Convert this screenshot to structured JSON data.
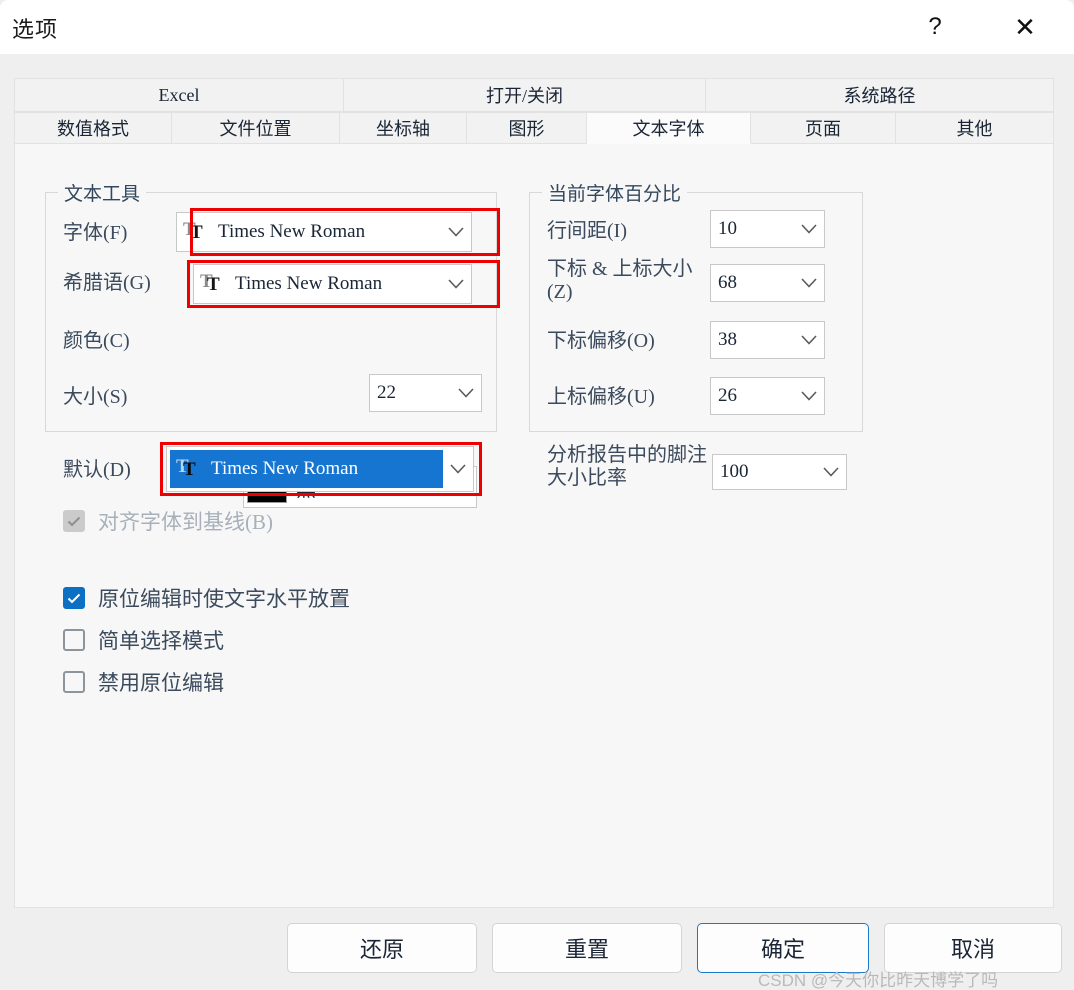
{
  "window": {
    "title": "选项",
    "help_label": "?",
    "close_label": "✕"
  },
  "tabs": {
    "row1": [
      {
        "label": "Excel",
        "active": false
      },
      {
        "label": "打开/关闭",
        "active": false
      },
      {
        "label": "系统路径",
        "active": false
      }
    ],
    "row2": [
      {
        "label": "数值格式",
        "active": false
      },
      {
        "label": "文件位置",
        "active": false
      },
      {
        "label": "坐标轴",
        "active": false
      },
      {
        "label": "图形",
        "active": false
      },
      {
        "label": "文本字体",
        "active": true
      },
      {
        "label": "页面",
        "active": false
      },
      {
        "label": "其他",
        "active": false
      }
    ]
  },
  "text_tools": {
    "group_title": "文本工具",
    "font_label": "字体(F)",
    "font_value": "Times New Roman",
    "greek_label": "希腊语(G)",
    "greek_value": "Times New Roman",
    "color_label": "颜色(C)",
    "color_value": "黑",
    "color_hex": "#000000",
    "size_label": "大小(S)",
    "size_value": "22"
  },
  "font_percent": {
    "group_title": "当前字体百分比",
    "line_spacing_label": "行间距(I)",
    "line_spacing_value": "10",
    "subsup_size_label": "下标 & 上标大小(Z)",
    "subsup_size_value": "68",
    "sub_offset_label": "下标偏移(O)",
    "sub_offset_value": "38",
    "sup_offset_label": "上标偏移(U)",
    "sup_offset_value": "26"
  },
  "default_font": {
    "label": "默认(D)",
    "value": "Times New Roman"
  },
  "footnote": {
    "label": "分析报告中的脚注大小比率",
    "value": "100"
  },
  "checkboxes": [
    {
      "label": "对齐字体到基线(B)",
      "checked": true,
      "disabled": true
    },
    {
      "label": "原位编辑时使文字水平放置",
      "checked": true,
      "disabled": false
    },
    {
      "label": "简单选择模式",
      "checked": false,
      "disabled": false
    },
    {
      "label": "禁用原位编辑",
      "checked": false,
      "disabled": false
    }
  ],
  "buttons": {
    "restore": "还原",
    "reset": "重置",
    "ok": "确定",
    "cancel": "取消"
  },
  "watermark": "CSDN @今天你比昨天博学了吗",
  "icons": {
    "truetype_back": "T",
    "truetype_front": "T"
  }
}
